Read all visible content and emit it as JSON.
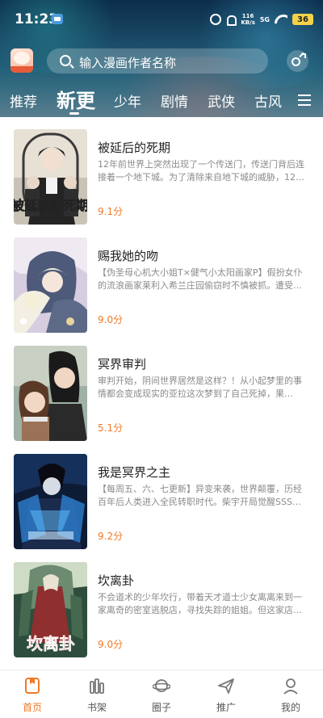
{
  "status_bar": {
    "time": "11:23",
    "net_speed_top": "116",
    "net_speed_bottom": "KB/s",
    "signal": "5G",
    "battery": "36"
  },
  "search": {
    "placeholder": "输入漫画作者名称"
  },
  "tabs": [
    {
      "label": "推荐",
      "active": false
    },
    {
      "label": "新更",
      "active": true
    },
    {
      "label": "少年",
      "active": false
    },
    {
      "label": "剧情",
      "active": false
    },
    {
      "label": "武侠",
      "active": false
    },
    {
      "label": "古风",
      "active": false
    }
  ],
  "comics": [
    {
      "title": "被延后的死期",
      "desc": "12年前世界上突然出现了一个传送门，传送门背后连接着一个地下城。为了清除来自地下城的威胁，12…",
      "rating": "9.1分",
      "cover_text": "被延后的死期"
    },
    {
      "title": "赐我她的吻",
      "desc": "【伪圣母心机大小姐T×健气小太阳画家P】假扮女仆的流浪画家莱利入希兰庄园偷窃时不慎被抓。遭受待…",
      "rating": "9.0分",
      "cover_text": ""
    },
    {
      "title": "冥界审判",
      "desc": "审判开始，阴间世界居然是这样？！从小起梦里的事情都会变成现实的亚拉这次梦到了自己死掉，果然，…",
      "rating": "5.1分",
      "cover_text": ""
    },
    {
      "title": "我是冥界之主",
      "desc": "【每周五、六、七更新】异变来袭，世界颠覆，历经百年后人类进入全民转职时代。柴宇开局觉醒SSS级…",
      "rating": "9.2分",
      "cover_text": ""
    },
    {
      "title": "坎离卦",
      "desc": "不会道术的少年坎行，带着天才道士少女离离来到一家离奇的密室逃脱店，寻找失踪的姐姐。但这家店…",
      "rating": "9.0分",
      "cover_text": "坎离卦"
    }
  ],
  "bottom_nav": [
    {
      "label": "首页",
      "icon": "home-icon",
      "active": true
    },
    {
      "label": "书架",
      "icon": "bookshelf-icon",
      "active": false
    },
    {
      "label": "圈子",
      "icon": "planet-icon",
      "active": false
    },
    {
      "label": "推广",
      "icon": "paper-plane-icon",
      "active": false
    },
    {
      "label": "我的",
      "icon": "profile-icon",
      "active": false
    }
  ],
  "colors": {
    "accent": "#f07a28",
    "header_dark": "#0b2d4b"
  }
}
